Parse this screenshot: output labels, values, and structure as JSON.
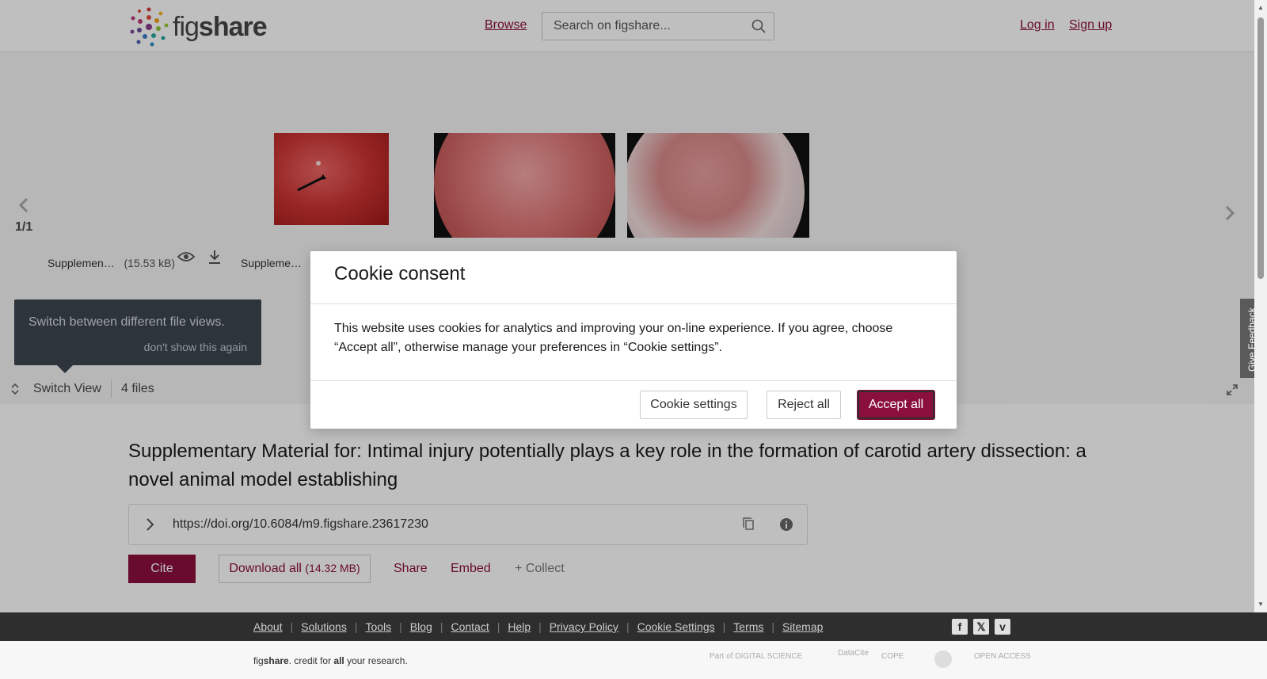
{
  "header": {
    "logo_text_regular": "fig",
    "logo_text_bold": "share",
    "browse_label": "Browse",
    "search_placeholder": "Search on figshare...",
    "login_label": "Log in",
    "signup_label": "Sign up"
  },
  "viewer": {
    "page_indicator": "1/1",
    "files": [
      {
        "name": "Supplemen…",
        "size": "(15.53 kB)"
      },
      {
        "name": "Suppleme…",
        "size": "("
      }
    ],
    "tooltip_text": "Switch between different file views.",
    "tooltip_dismiss": "don't show this again",
    "switch_view_label": "Switch View",
    "files_count": "4 files",
    "feedback_label": "Give Feedback"
  },
  "article": {
    "title": "Supplementary Material for: Intimal injury potentially plays a key role in the formation of carotid artery dissection: a novel animal model establishing",
    "doi": "https://doi.org/10.6084/m9.figshare.23617230",
    "cite_label": "Cite",
    "download_all_label": "Download all",
    "download_all_size": "(14.32 MB)",
    "share_label": "Share",
    "embed_label": "Embed",
    "collect_label": "+ Collect"
  },
  "cookie_modal": {
    "title": "Cookie consent",
    "body": "This website uses cookies for analytics and improving your on-line experience. If you agree, choose “Accept all”, otherwise manage your preferences in “Cookie settings”.",
    "settings_label": "Cookie settings",
    "reject_label": "Reject all",
    "accept_label": "Accept all"
  },
  "footer": {
    "links": [
      "About",
      "Solutions",
      "Tools",
      "Blog",
      "Contact",
      "Help",
      "Privacy Policy",
      "Cookie Settings",
      "Terms",
      "Sitemap"
    ],
    "social": [
      "facebook-icon",
      "x-icon",
      "vimeo-icon"
    ],
    "tagline_pre": "fig",
    "tagline_bold": "share",
    "tagline_mid": ". credit for ",
    "tagline_all": "all",
    "tagline_post": " your research.",
    "partners": [
      "Part of DIGITAL SCIENCE",
      "DataCite",
      "COPE",
      "",
      "OPEN ACCESS"
    ]
  },
  "colors": {
    "brand": "#8b0f3d",
    "footer_dark": "#2e2e2e"
  }
}
